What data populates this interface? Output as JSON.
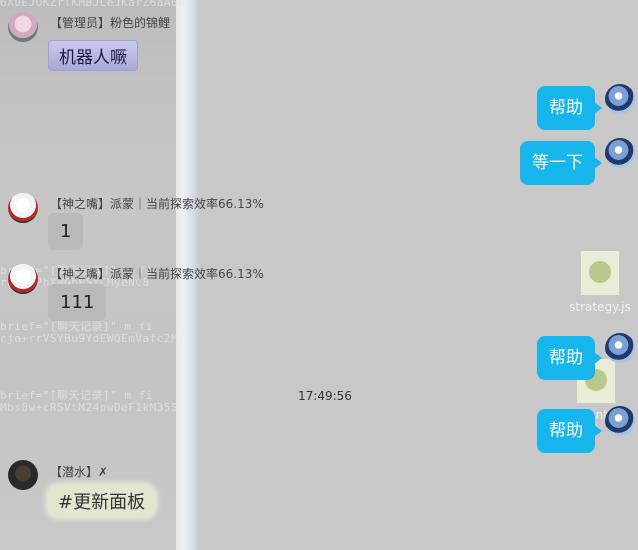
{
  "background_code": [
    "6XuEJOKZrlKMBJLeJKarZ6aA0e",
    "brief=\"[聊天记录]\" m_fi",
    "rDAcaPhXWGhPSYCMyeNC8",
    "brief=\"[聊天记录]\" m_fi",
    "cjo+rrVSYBu9YdEWQEmVafc2M",
    "brief=\"[聊天记录]\" m_fi",
    "Mbs8w+cRSVtM24pwDeF1kM35S"
  ],
  "messages": {
    "admin": {
      "sender": "【管理员】粉色的锦鲤",
      "text": "机器人噘"
    },
    "god1": {
      "sender": "【神之嘴】派蒙｜当前探索效率66.13%",
      "text": "1"
    },
    "god2": {
      "sender": "【神之嘴】派蒙｜当前探索效率66.13%",
      "text": "111"
    },
    "diver": {
      "sender": "【潜水】✗",
      "text": "#更新面板"
    }
  },
  "self_messages": [
    "帮助",
    "等一下",
    "帮助",
    "帮助"
  ],
  "timestamp": "17:49:56",
  "files": [
    {
      "name": "strategy.js"
    },
    {
      "name": "month"
    }
  ],
  "colors": {
    "bubble_blue": "#16b5ec",
    "background": "#c8c8c8"
  }
}
